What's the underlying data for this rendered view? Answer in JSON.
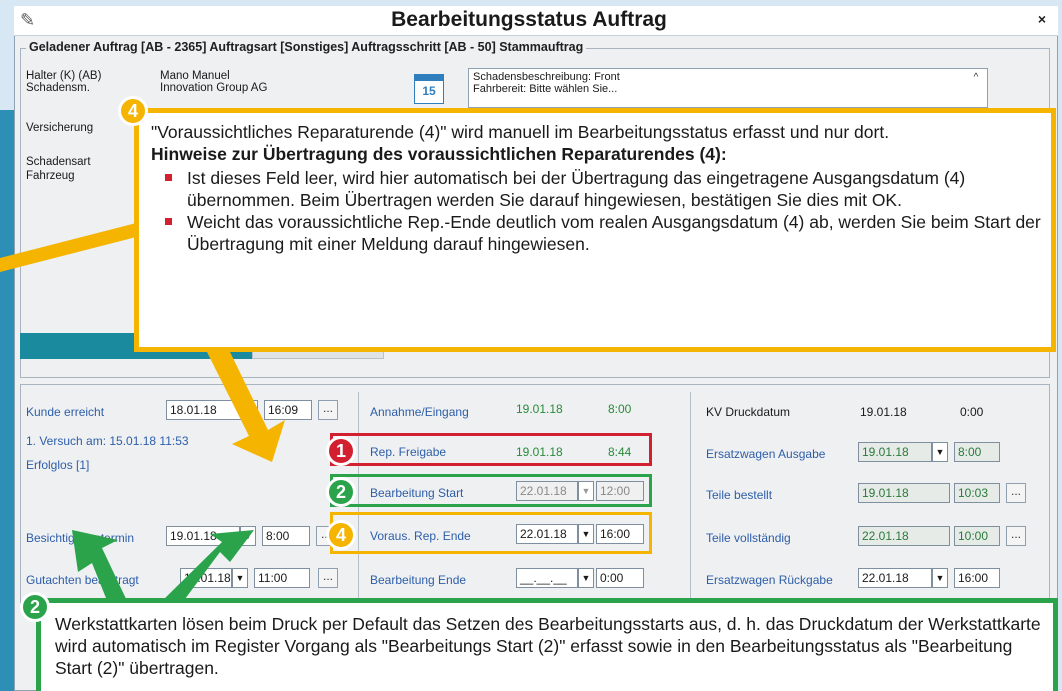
{
  "window": {
    "title": "Bearbeitungsstatus Auftrag",
    "close": "×",
    "group_title": "Geladener Auftrag [AB - 2365] Auftragsart [Sonstiges] Auftragsschritt [AB - 50] Stammauftrag"
  },
  "top_info": {
    "halter_label": "Halter (K) (AB)",
    "halter_value": "Mano Manuel",
    "schadensm_label": "Schadensm.",
    "schadensm_value": "Innovation Group AG",
    "versicherung_label": "Versicherung",
    "schadensart_label": "Schadensart",
    "fahrzeug_label": "Fahrzeug",
    "calendar_day": "15",
    "description_line1": "Schadensbeschreibung: Front",
    "description_line2": "Fahrbereit: Bitte wählen Sie..."
  },
  "status": {
    "kunde_erreicht_label": "Kunde erreicht",
    "kunde_erreicht_date": "18.01.18",
    "kunde_erreicht_time": "16:09",
    "versuch_text": "1. Versuch am: 15.01.18 11:53",
    "erfolglos_text": "Erfolglos [1]",
    "besichtigung_label": "Besichtigungstermin",
    "besichtigung_date": "19.01.18",
    "besichtigung_time": "8:00",
    "gutachten_label": "Gutachten beauftragt",
    "gutachten_date": "19.01.18",
    "gutachten_time": "11:00",
    "annahme_label": "Annahme/Eingang",
    "annahme_date": "19.01.18",
    "annahme_time": "8:00",
    "rep_freigabe_label": "Rep. Freigabe",
    "rep_freigabe_date": "19.01.18",
    "rep_freigabe_time": "8:44",
    "bearb_start_label": "Bearbeitung Start",
    "bearb_start_date": "22.01.18",
    "bearb_start_time": "12:00",
    "voraus_label": "Voraus. Rep. Ende",
    "voraus_date": "22.01.18",
    "voraus_time": "16:00",
    "bearb_ende_label": "Bearbeitung Ende",
    "bearb_ende_date": "__.__.__",
    "bearb_ende_time": "0:00",
    "kv_label": "KV Druckdatum",
    "kv_date": "19.01.18",
    "kv_time": "0:00",
    "ersatz_ausgabe_label": "Ersatzwagen Ausgabe",
    "ersatz_ausgabe_date": "19.01.18",
    "ersatz_ausgabe_time": "8:00",
    "teile_bestellt_label": "Teile bestellt",
    "teile_bestellt_date": "19.01.18",
    "teile_bestellt_time": "10:03",
    "teile_vollst_label": "Teile vollständig",
    "teile_vollst_date": "22.01.18",
    "teile_vollst_time": "10:00",
    "ersatz_rueckgabe_label": "Ersatzwagen Rückgabe",
    "ersatz_rueckgabe_date": "22.01.18",
    "ersatz_rueckgabe_time": "16:00",
    "dots": "..."
  },
  "markers": {
    "one": "1",
    "two": "2",
    "four": "4"
  },
  "callout_yellow": {
    "line1": "\"Voraussichtliches Reparaturende (4)\" wird manuell im Bearbeitungsstatus erfasst und nur dort.",
    "heading": "Hinweise zur Übertragung des voraussichtlichen Reparaturendes (4):",
    "bullet1": "Ist dieses Feld leer, wird hier automatisch bei der Übertragung das eingetragene Ausgangsdatum (4) übernommen. Beim Übertragen werden Sie darauf hingewiesen, bestätigen Sie dies mit OK.",
    "bullet2": "Weicht das voraussichtliche Rep.-Ende deutlich vom realen Ausgangsdatum (4) ab, werden Sie beim Start der Übertragung mit einer Meldung darauf hingewiesen."
  },
  "callout_green": {
    "text": "Werkstattkarten lösen beim Druck per Default das Setzen des Bearbeitungsstarts aus, d. h. das Druckdatum der Werkstattkarte wird automatisch im Register Vorgang als \"Bearbeitungs Start (2)\" erfasst sowie in den Bearbeitungsstatus als \"Bearbeitung Start (2)\" übertragen."
  },
  "colors": {
    "red": "#d32030",
    "green": "#2ba34b",
    "yellow": "#f5b400",
    "progress": "#1a8a9e"
  }
}
